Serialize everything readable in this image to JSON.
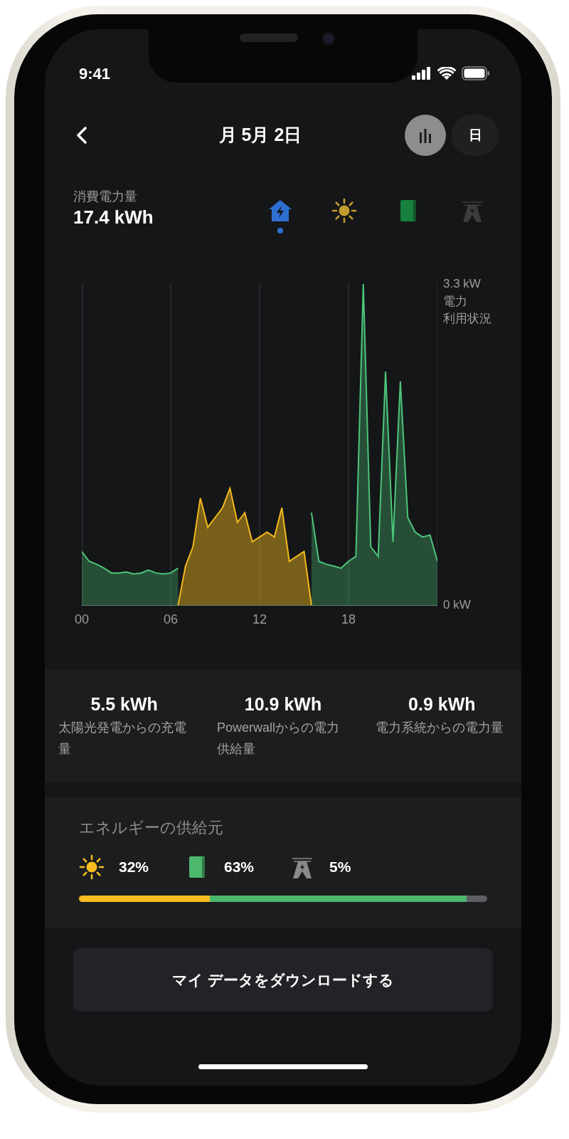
{
  "status_bar": {
    "time": "9:41"
  },
  "header": {
    "title": "月 5月 2日",
    "view_toggle": [
      {
        "kind": "chart",
        "selected": true
      },
      {
        "kind": "text",
        "label": "日",
        "selected": false
      }
    ]
  },
  "summary": {
    "label": "消費電力量",
    "value": "17.4 kWh"
  },
  "source_filters": [
    {
      "kind": "home",
      "selected": true
    },
    {
      "kind": "solar",
      "selected": false
    },
    {
      "kind": "powerwall",
      "selected": false
    },
    {
      "kind": "grid",
      "selected": false
    }
  ],
  "chart_data": {
    "type": "area",
    "ylabel": "電力利用状況",
    "grid": true,
    "xlim": [
      0,
      24
    ],
    "ylim": [
      0,
      3.3
    ],
    "xticks": [
      {
        "value": 0,
        "label": "00"
      },
      {
        "value": 6,
        "label": "06"
      },
      {
        "value": 12,
        "label": "12"
      },
      {
        "value": 18,
        "label": "18"
      }
    ],
    "yticks": [
      {
        "value": 0,
        "label": "0 kW"
      },
      {
        "value": 3.3,
        "label": "3.3 kW"
      }
    ],
    "x": [
      0,
      0.5,
      1,
      1.5,
      2,
      2.5,
      3,
      3.5,
      4,
      4.5,
      5,
      5.5,
      6,
      6.5,
      7,
      7.5,
      8,
      8.5,
      9,
      9.5,
      10,
      10.5,
      11,
      11.5,
      12,
      12.5,
      13,
      13.5,
      14,
      14.5,
      15,
      15.5,
      16,
      16.5,
      17,
      17.5,
      18,
      18.5,
      19,
      19.5,
      20,
      20.5,
      21,
      21.5,
      22,
      22.5,
      23,
      23.5,
      24
    ],
    "series": [
      {
        "color": "#4cc57a",
        "values": [
          0.55,
          0.45,
          0.42,
          0.38,
          0.33,
          0.33,
          0.34,
          0.32,
          0.33,
          0.36,
          0.33,
          0.32,
          0.33,
          0.38,
          null,
          null,
          null,
          null,
          null,
          null,
          null,
          null,
          null,
          null,
          null,
          null,
          null,
          null,
          null,
          null,
          null,
          0.95,
          0.45,
          0.42,
          0.4,
          0.38,
          0.45,
          0.5,
          3.3,
          0.6,
          0.5,
          2.4,
          0.65,
          2.3,
          0.9,
          0.75,
          0.7,
          0.72,
          0.45
        ]
      },
      {
        "color": "#f2b91d",
        "values": [
          null,
          null,
          null,
          null,
          null,
          null,
          null,
          null,
          null,
          null,
          null,
          null,
          null,
          0,
          0.4,
          0.6,
          1.1,
          0.8,
          0.9,
          1.0,
          1.2,
          0.85,
          0.95,
          0.65,
          0.7,
          0.75,
          0.7,
          1.0,
          0.45,
          0.5,
          0.55,
          0,
          null,
          null,
          null,
          null,
          null,
          null,
          null,
          null,
          null,
          null,
          null,
          null,
          null,
          null,
          null,
          null,
          null
        ]
      }
    ]
  },
  "stats": [
    {
      "value": "5.5 kWh",
      "label": "太陽光発電からの充電量"
    },
    {
      "value": "10.9 kWh",
      "label": "Powerwallからの電力供給量"
    },
    {
      "value": "0.9 kWh",
      "label": "電力系統からの電力量"
    }
  ],
  "energy_sources": {
    "title": "エネルギーの供給元",
    "items": [
      {
        "kind": "solar",
        "percent": "32%",
        "color": "#f5bd1f"
      },
      {
        "kind": "powerwall",
        "percent": "63%",
        "color": "#4cb86e"
      },
      {
        "kind": "grid",
        "percent": "5%",
        "color": "#5f6063"
      }
    ]
  },
  "download_button": {
    "label": "マイ データをダウンロードする"
  }
}
